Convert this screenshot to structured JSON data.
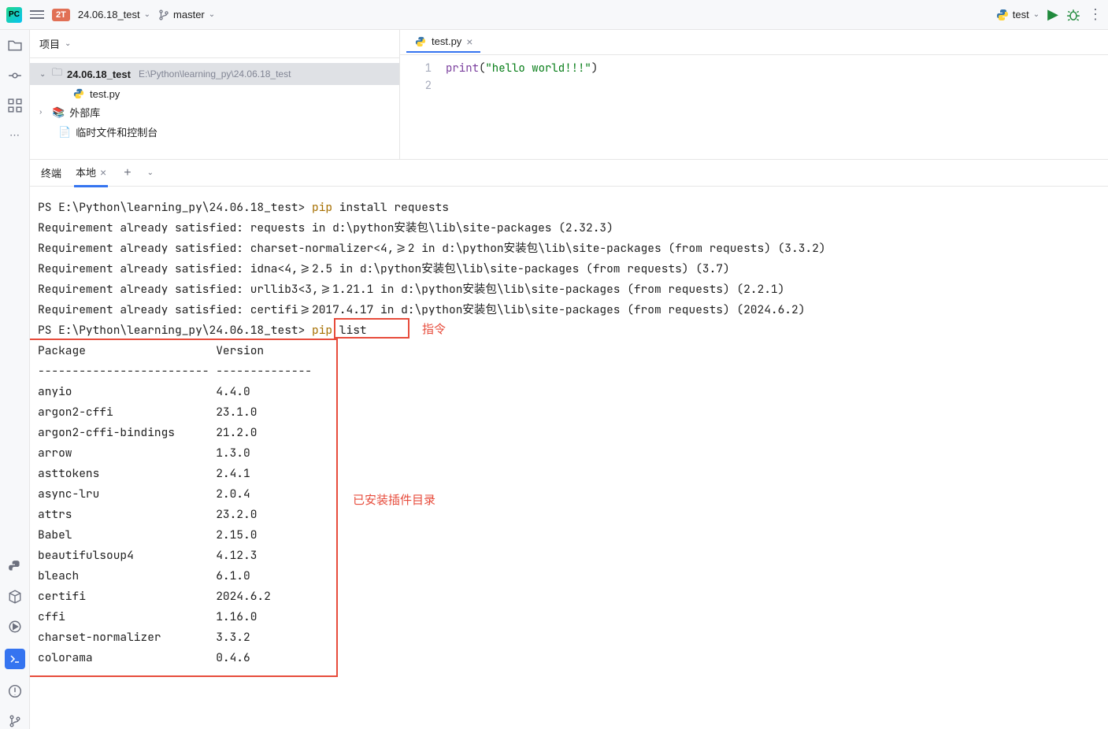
{
  "toolbar": {
    "badge": "2T",
    "project_name": "24.06.18_test",
    "branch": "master",
    "run_config": "test"
  },
  "project_panel": {
    "title": "项目",
    "root": {
      "name": "24.06.18_test",
      "path": "E:\\Python\\learning_py\\24.06.18_test"
    },
    "file": "test.py",
    "ext_libs": "外部库",
    "scratches": "临时文件和控制台"
  },
  "editor": {
    "tab_name": "test.py",
    "lines": [
      "1",
      "2"
    ],
    "code_fn": "print",
    "code_str": "\"hello world!!!\""
  },
  "terminal": {
    "tab_main": "终端",
    "tab_local": "本地",
    "prompt_path": "PS E:\\Python\\learning_py\\24.06.18_test> ",
    "cmd1_pip": "pip",
    "cmd1_rest": " install requests",
    "req_lines": [
      "Requirement already satisfied: requests in d:\\python安装包\\lib\\site-packages (2.32.3)",
      "Requirement already satisfied: charset-normalizer<4,>=2 in d:\\python安装包\\lib\\site-packages (from requests) (3.3.2)",
      "Requirement already satisfied: idna<4,>=2.5 in d:\\python安装包\\lib\\site-packages (from requests) (3.7)",
      "Requirement already satisfied: urllib3<3,>=1.21.1 in d:\\python安装包\\lib\\site-packages (from requests) (2.2.1)",
      "Requirement already satisfied: certifi>=2017.4.17 in d:\\python安装包\\lib\\site-packages (from requests) (2024.6.2)"
    ],
    "cmd2_pip": "pip",
    "cmd2_rest": " list",
    "pkg_header": "Package                   Version",
    "pkg_divider": "------------------------- --------------",
    "packages": [
      "anyio                     4.4.0",
      "argon2-cffi               23.1.0",
      "argon2-cffi-bindings      21.2.0",
      "arrow                     1.3.0",
      "asttokens                 2.4.1",
      "async-lru                 2.0.4",
      "attrs                     23.2.0",
      "Babel                     2.15.0",
      "beautifulsoup4            4.12.3",
      "bleach                    6.1.0",
      "certifi                   2024.6.2",
      "cffi                      1.16.0",
      "charset-normalizer        3.3.2",
      "colorama                  0.4.6"
    ],
    "annotation_cmd": "指令",
    "annotation_list": "已安装插件目录"
  }
}
